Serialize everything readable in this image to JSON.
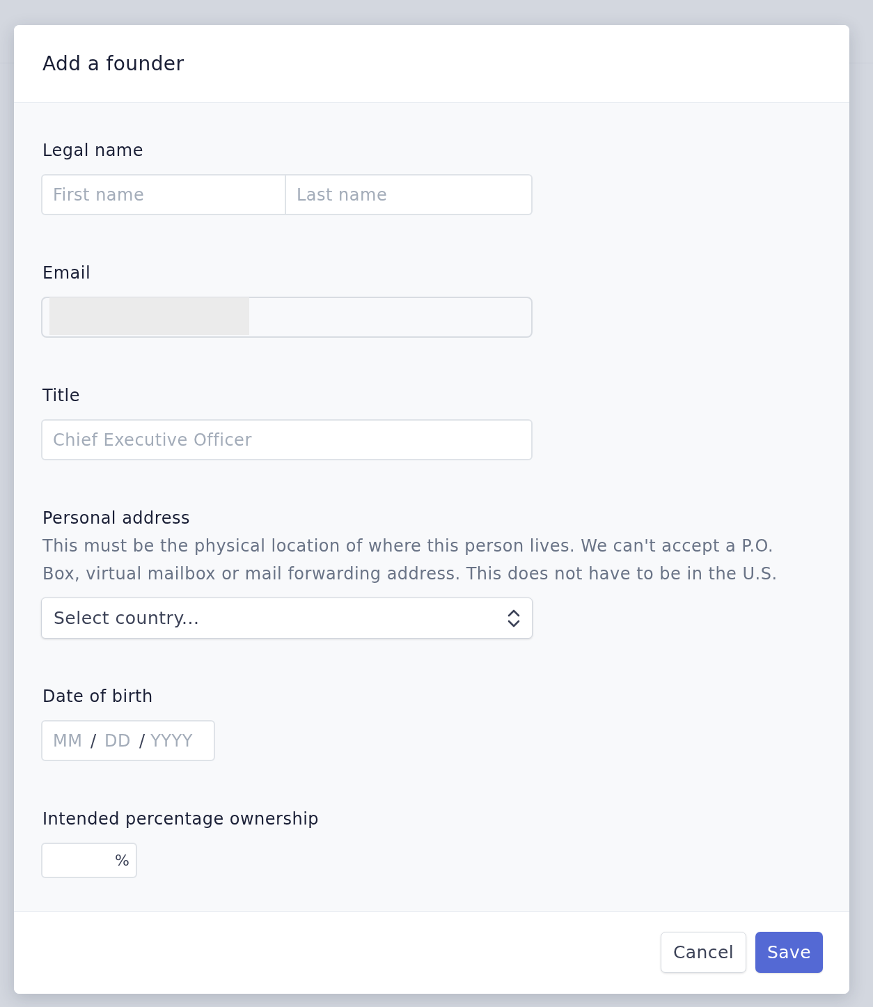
{
  "dialog": {
    "title": "Add a founder"
  },
  "fields": [
    {
      "kind": "name",
      "label": "Legal name",
      "inputs": [
        {
          "placeholder": "First name"
        },
        {
          "placeholder": "Last name"
        }
      ]
    },
    {
      "kind": "email",
      "label": "Email",
      "redacted": true
    },
    {
      "kind": "text",
      "label": "Title",
      "placeholder": "Chief Executive Officer"
    },
    {
      "kind": "select",
      "label": "Personal address",
      "help": "This must be the physical location of where this person lives. We can't accept a P.O. Box, virtual mailbox or mail forwarding address. This does not have to be in the U.S.",
      "value": "Select country..."
    },
    {
      "kind": "date",
      "label": "Date of birth",
      "parts": [
        {
          "placeholder": "MM"
        },
        {
          "placeholder": "DD"
        },
        {
          "placeholder": "YYYY"
        }
      ],
      "separators": [
        "/",
        "/"
      ]
    },
    {
      "kind": "percent",
      "label": "Intended percentage ownership",
      "suffix": "%"
    }
  ],
  "buttons": [
    {
      "kind": "secondary",
      "label": "Cancel"
    },
    {
      "kind": "primary",
      "label": "Save"
    }
  ]
}
